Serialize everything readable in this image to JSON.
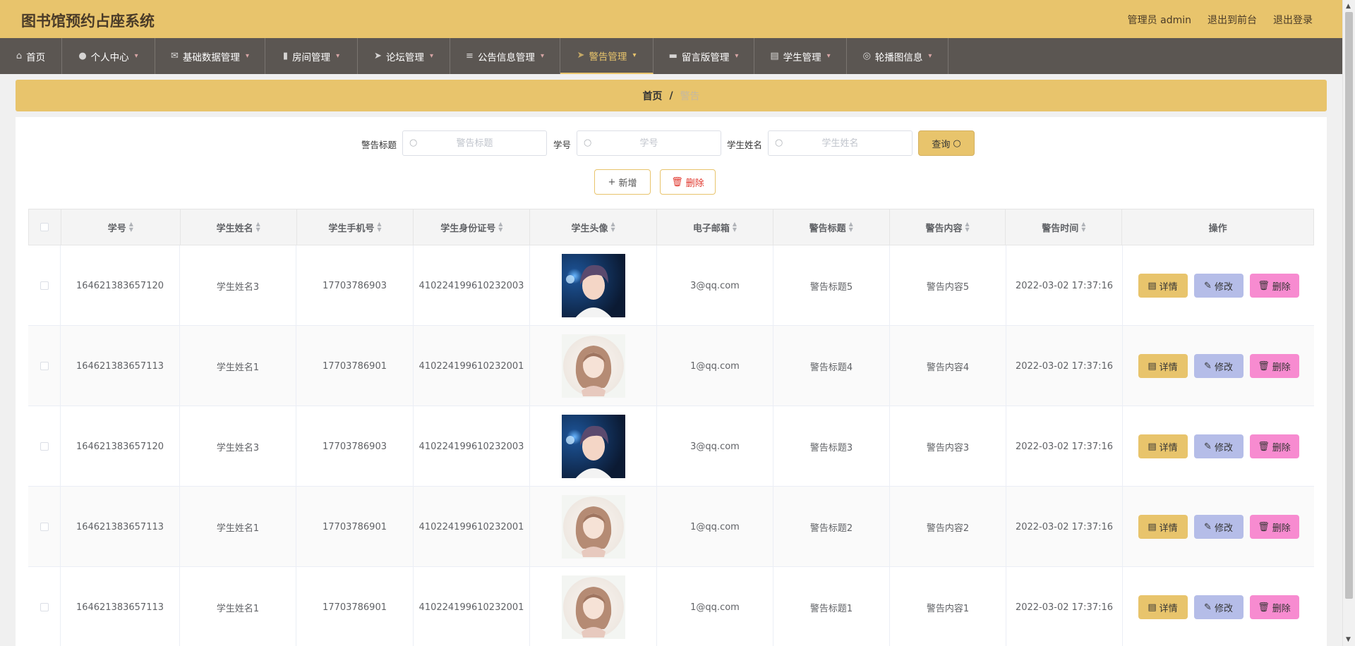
{
  "header": {
    "title": "图书馆预约占座系统",
    "user_label": "管理员 admin",
    "front_link": "退出到前台",
    "logout_link": "退出登录"
  },
  "nav": {
    "items": [
      {
        "label": "首页",
        "icon": "home-icon"
      },
      {
        "label": "个人中心",
        "icon": "user-icon"
      },
      {
        "label": "基础数据管理",
        "icon": "mail-icon"
      },
      {
        "label": "房间管理",
        "icon": "chart-icon"
      },
      {
        "label": "论坛管理",
        "icon": "send-icon"
      },
      {
        "label": "公告信息管理",
        "icon": "menu-icon"
      },
      {
        "label": "警告管理",
        "icon": "send-icon"
      },
      {
        "label": "留言版管理",
        "icon": "briefcase-icon"
      },
      {
        "label": "学生管理",
        "icon": "clipboard-icon"
      },
      {
        "label": "轮播图信息",
        "icon": "compass-icon"
      }
    ],
    "active": "警告管理"
  },
  "breadcrumb": {
    "home": "首页",
    "separator": "/",
    "current": "警告"
  },
  "search": {
    "title_label": "警告标题",
    "title_placeholder": "警告标题",
    "id_label": "学号",
    "id_placeholder": "学号",
    "name_label": "学生姓名",
    "name_placeholder": "学生姓名",
    "query_button": "查询"
  },
  "toolbar": {
    "add_button": "新增",
    "delete_button": "删除"
  },
  "table": {
    "columns": [
      "学号",
      "学生姓名",
      "学生手机号",
      "学生身份证号",
      "学生头像",
      "电子邮箱",
      "警告标题",
      "警告内容",
      "警告时间",
      "操作"
    ],
    "rows": [
      {
        "student_id": "164621383657120",
        "name": "学生姓名3",
        "phone": "17703786903",
        "id_card": "410224199610232003",
        "avatar": "boy",
        "email": "3@qq.com",
        "title": "警告标题5",
        "content": "警告内容5",
        "time": "2022-03-02 17:37:16"
      },
      {
        "student_id": "164621383657113",
        "name": "学生姓名1",
        "phone": "17703786901",
        "id_card": "410224199610232001",
        "avatar": "girl",
        "email": "1@qq.com",
        "title": "警告标题4",
        "content": "警告内容4",
        "time": "2022-03-02 17:37:16"
      },
      {
        "student_id": "164621383657120",
        "name": "学生姓名3",
        "phone": "17703786903",
        "id_card": "410224199610232003",
        "avatar": "boy",
        "email": "3@qq.com",
        "title": "警告标题3",
        "content": "警告内容3",
        "time": "2022-03-02 17:37:16"
      },
      {
        "student_id": "164621383657113",
        "name": "学生姓名1",
        "phone": "17703786901",
        "id_card": "410224199610232001",
        "avatar": "girl",
        "email": "1@qq.com",
        "title": "警告标题2",
        "content": "警告内容2",
        "time": "2022-03-02 17:37:16"
      },
      {
        "student_id": "164621383657113",
        "name": "学生姓名1",
        "phone": "17703786901",
        "id_card": "410224199610232001",
        "avatar": "girl",
        "email": "1@qq.com",
        "title": "警告标题1",
        "content": "警告内容1",
        "time": "2022-03-02 17:37:16"
      }
    ],
    "actions": {
      "detail": "详情",
      "edit": "修改",
      "remove": "删除"
    }
  },
  "colors": {
    "accent": "#e8c46c",
    "nav_bg": "#5b5652",
    "edit_btn": "#b5bde8",
    "remove_btn": "#f78bd0"
  }
}
